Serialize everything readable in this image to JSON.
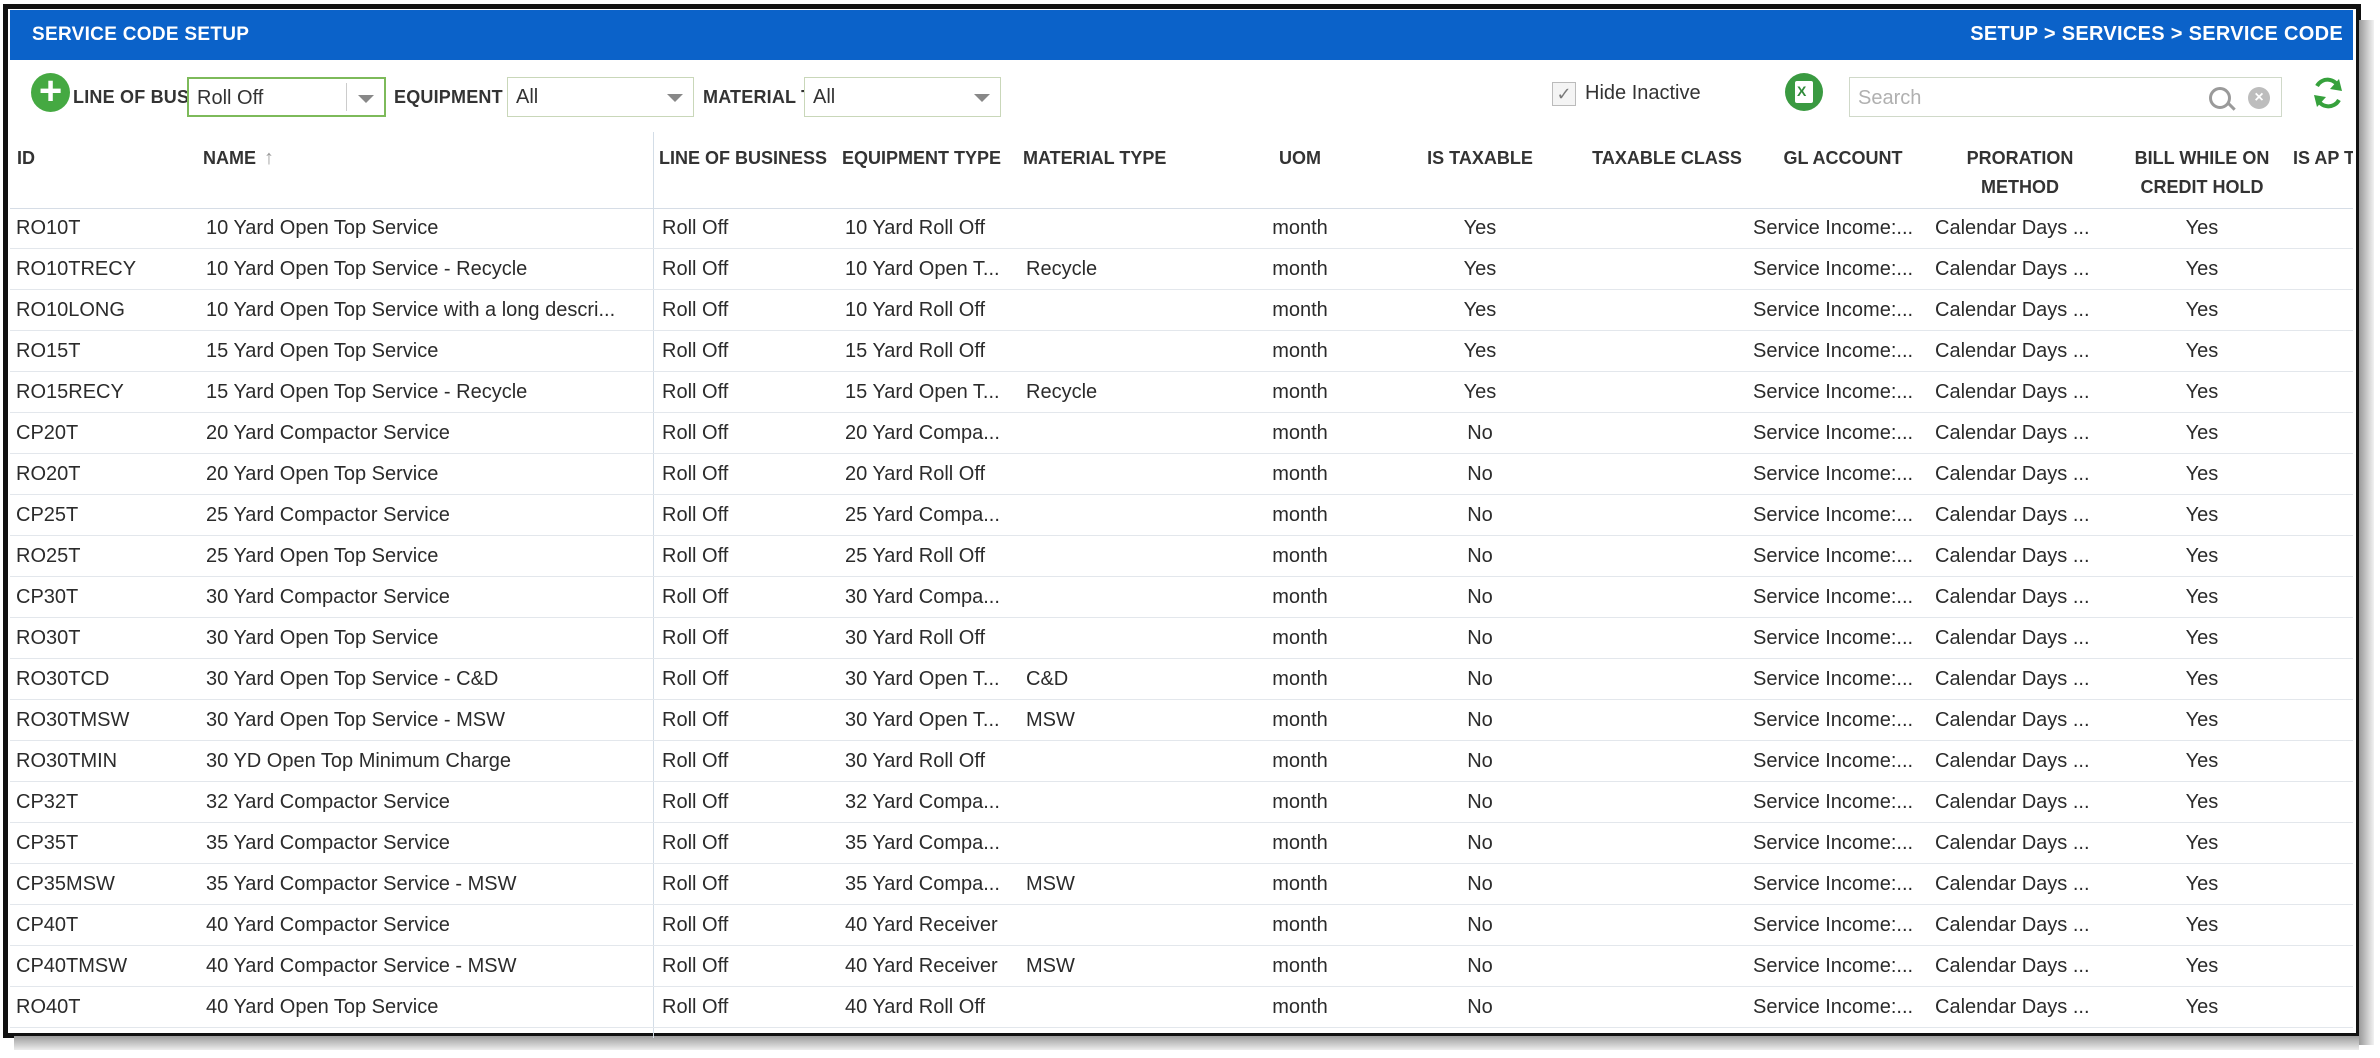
{
  "title": "SERVICE CODE SETUP",
  "breadcrumb": "SETUP > SERVICES > SERVICE CODE",
  "toolbar": {
    "add_icon": "plus-circle-icon",
    "line_of_business_label": "LINE OF BUSINESS",
    "line_of_business_value": "Roll Off",
    "equipment_type_label": "EQUIPMENT TYPE",
    "equipment_type_value": "All",
    "material_type_label": "MATERIAL TYPE",
    "material_type_value": "All",
    "hide_inactive_label": "Hide Inactive",
    "hide_inactive_checked": true,
    "search_placeholder": "Search"
  },
  "colors": {
    "titlebar": "#0b62c9",
    "accent_green": "#45a942"
  },
  "columns": {
    "id": "ID",
    "name": "NAME",
    "line_of_business": "LINE OF BUSINESS",
    "equipment_type": "EQUIPMENT TYPE",
    "material_type": "MATERIAL TYPE",
    "uom": "UOM",
    "is_taxable": "IS TAXABLE",
    "taxable_class": "TAXABLE CLASS",
    "gl_account": "GL ACCOUNT",
    "proration_method_1": "PRORATION",
    "proration_method_2": "METHOD",
    "bill_credit_hold_1": "BILL WHILE ON",
    "bill_credit_hold_2": "CREDIT HOLD",
    "is_ap": "IS AP T"
  },
  "rows": [
    {
      "id": "RO10T",
      "name": "10 Yard Open Top Service",
      "lob": "Roll Off",
      "equip": "10 Yard Roll Off",
      "material": "",
      "uom": "month",
      "taxable": "Yes",
      "tax_class": "",
      "gl": "Service Income:...",
      "proration": "Calendar Days ...",
      "bill_hold": "Yes"
    },
    {
      "id": "RO10TRECY",
      "name": "10 Yard Open Top Service - Recycle",
      "lob": "Roll Off",
      "equip": "10 Yard Open T...",
      "material": "Recycle",
      "uom": "month",
      "taxable": "Yes",
      "tax_class": "",
      "gl": "Service Income:...",
      "proration": "Calendar Days ...",
      "bill_hold": "Yes"
    },
    {
      "id": "RO10LONG",
      "name": "10 Yard Open Top Service with a long descri...",
      "lob": "Roll Off",
      "equip": "10 Yard Roll Off",
      "material": "",
      "uom": "month",
      "taxable": "Yes",
      "tax_class": "",
      "gl": "Service Income:...",
      "proration": "Calendar Days ...",
      "bill_hold": "Yes"
    },
    {
      "id": "RO15T",
      "name": "15 Yard Open Top Service",
      "lob": "Roll Off",
      "equip": "15 Yard Roll Off",
      "material": "",
      "uom": "month",
      "taxable": "Yes",
      "tax_class": "",
      "gl": "Service Income:...",
      "proration": "Calendar Days ...",
      "bill_hold": "Yes"
    },
    {
      "id": "RO15RECY",
      "name": "15 Yard Open Top Service - Recycle",
      "lob": "Roll Off",
      "equip": "15 Yard Open T...",
      "material": "Recycle",
      "uom": "month",
      "taxable": "Yes",
      "tax_class": "",
      "gl": "Service Income:...",
      "proration": "Calendar Days ...",
      "bill_hold": "Yes"
    },
    {
      "id": "CP20T",
      "name": "20 Yard Compactor Service",
      "lob": "Roll Off",
      "equip": "20 Yard Compa...",
      "material": "",
      "uom": "month",
      "taxable": "No",
      "tax_class": "",
      "gl": "Service Income:...",
      "proration": "Calendar Days ...",
      "bill_hold": "Yes"
    },
    {
      "id": "RO20T",
      "name": "20 Yard Open Top Service",
      "lob": "Roll Off",
      "equip": "20 Yard Roll Off",
      "material": "",
      "uom": "month",
      "taxable": "No",
      "tax_class": "",
      "gl": "Service Income:...",
      "proration": "Calendar Days ...",
      "bill_hold": "Yes"
    },
    {
      "id": "CP25T",
      "name": "25 Yard Compactor Service",
      "lob": "Roll Off",
      "equip": "25 Yard Compa...",
      "material": "",
      "uom": "month",
      "taxable": "No",
      "tax_class": "",
      "gl": "Service Income:...",
      "proration": "Calendar Days ...",
      "bill_hold": "Yes"
    },
    {
      "id": "RO25T",
      "name": "25 Yard Open Top Service",
      "lob": "Roll Off",
      "equip": "25 Yard Roll Off",
      "material": "",
      "uom": "month",
      "taxable": "No",
      "tax_class": "",
      "gl": "Service Income:...",
      "proration": "Calendar Days ...",
      "bill_hold": "Yes"
    },
    {
      "id": "CP30T",
      "name": "30 Yard Compactor Service",
      "lob": "Roll Off",
      "equip": "30 Yard Compa...",
      "material": "",
      "uom": "month",
      "taxable": "No",
      "tax_class": "",
      "gl": "Service Income:...",
      "proration": "Calendar Days ...",
      "bill_hold": "Yes"
    },
    {
      "id": "RO30T",
      "name": "30 Yard Open Top Service",
      "lob": "Roll Off",
      "equip": "30 Yard Roll Off",
      "material": "",
      "uom": "month",
      "taxable": "No",
      "tax_class": "",
      "gl": "Service Income:...",
      "proration": "Calendar Days ...",
      "bill_hold": "Yes"
    },
    {
      "id": "RO30TCD",
      "name": "30 Yard Open Top Service - C&D",
      "lob": "Roll Off",
      "equip": "30 Yard Open T...",
      "material": "C&D",
      "uom": "month",
      "taxable": "No",
      "tax_class": "",
      "gl": "Service Income:...",
      "proration": "Calendar Days ...",
      "bill_hold": "Yes"
    },
    {
      "id": "RO30TMSW",
      "name": "30 Yard Open Top Service - MSW",
      "lob": "Roll Off",
      "equip": "30 Yard Open T...",
      "material": "MSW",
      "uom": "month",
      "taxable": "No",
      "tax_class": "",
      "gl": "Service Income:...",
      "proration": "Calendar Days ...",
      "bill_hold": "Yes"
    },
    {
      "id": "RO30TMIN",
      "name": "30 YD Open Top Minimum Charge",
      "lob": "Roll Off",
      "equip": "30 Yard Roll Off",
      "material": "",
      "uom": "month",
      "taxable": "No",
      "tax_class": "",
      "gl": "Service Income:...",
      "proration": "Calendar Days ...",
      "bill_hold": "Yes"
    },
    {
      "id": "CP32T",
      "name": "32 Yard Compactor Service",
      "lob": "Roll Off",
      "equip": "32 Yard Compa...",
      "material": "",
      "uom": "month",
      "taxable": "No",
      "tax_class": "",
      "gl": "Service Income:...",
      "proration": "Calendar Days ...",
      "bill_hold": "Yes"
    },
    {
      "id": "CP35T",
      "name": "35 Yard Compactor Service",
      "lob": "Roll Off",
      "equip": "35 Yard Compa...",
      "material": "",
      "uom": "month",
      "taxable": "No",
      "tax_class": "",
      "gl": "Service Income:...",
      "proration": "Calendar Days ...",
      "bill_hold": "Yes"
    },
    {
      "id": "CP35MSW",
      "name": "35 Yard Compactor Service - MSW",
      "lob": "Roll Off",
      "equip": "35 Yard Compa...",
      "material": "MSW",
      "uom": "month",
      "taxable": "No",
      "tax_class": "",
      "gl": "Service Income:...",
      "proration": "Calendar Days ...",
      "bill_hold": "Yes"
    },
    {
      "id": "CP40T",
      "name": "40 Yard Compactor Service",
      "lob": "Roll Off",
      "equip": "40 Yard Receiver",
      "material": "",
      "uom": "month",
      "taxable": "No",
      "tax_class": "",
      "gl": "Service Income:...",
      "proration": "Calendar Days ...",
      "bill_hold": "Yes"
    },
    {
      "id": "CP40TMSW",
      "name": "40 Yard Compactor Service - MSW",
      "lob": "Roll Off",
      "equip": "40 Yard Receiver",
      "material": "MSW",
      "uom": "month",
      "taxable": "No",
      "tax_class": "",
      "gl": "Service Income:...",
      "proration": "Calendar Days ...",
      "bill_hold": "Yes"
    },
    {
      "id": "RO40T",
      "name": "40 Yard Open Top Service",
      "lob": "Roll Off",
      "equip": "40 Yard Roll Off",
      "material": "",
      "uom": "month",
      "taxable": "No",
      "tax_class": "",
      "gl": "Service Income:...",
      "proration": "Calendar Days ...",
      "bill_hold": "Yes"
    }
  ]
}
